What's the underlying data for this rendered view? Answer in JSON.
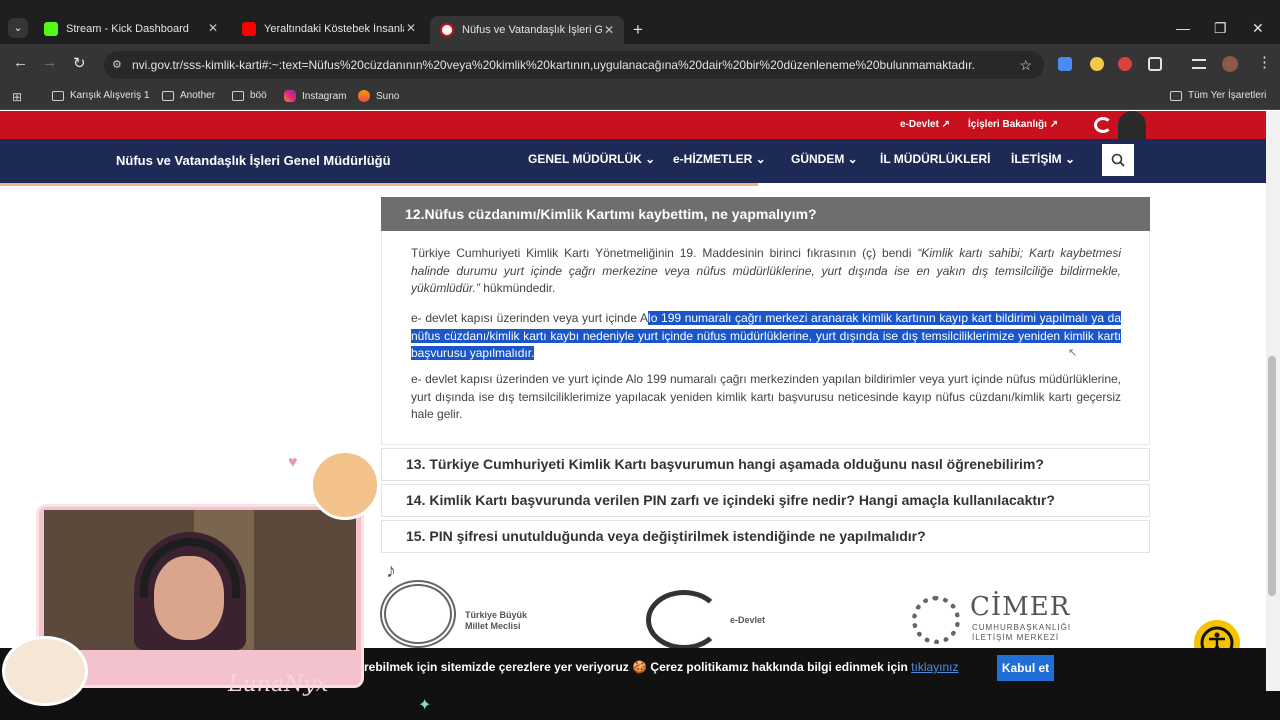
{
  "browser": {
    "tabs": [
      {
        "title": "Stream - Kick Dashboard",
        "favicon_color": "#53fc18"
      },
      {
        "title": "Yeraltındaki Köstebek İnsanlar'a",
        "favicon_color": "#ff0000"
      },
      {
        "title": "Nüfus ve Vatandaşlık İşleri Genel",
        "favicon_color": "#c8101e"
      }
    ],
    "url": "nvi.gov.tr/sss-kimlik-karti#:~:text=Nüfus%20cüzdanının%20veya%20kimlik%20kartının,uygulanacağına%20dair%20bir%20düzenleneme%20bulunmamaktadır.",
    "bookmarks": [
      "Karışık Alışveriş 1",
      "Another",
      "böö",
      "Instagram",
      "Suno"
    ],
    "all_bookmarks": "Tüm Yer İşaretleri"
  },
  "site": {
    "top_links": [
      "e-Devlet",
      "İçişleri Bakanlığı"
    ],
    "title": "Nüfus ve Vatandaşlık İşleri Genel Müdürlüğü",
    "menu": [
      "GENEL MÜDÜRLÜK",
      "e-HİZMETLER",
      "GÜNDEM",
      "İL MÜDÜRLÜKLERİ",
      "İLETİŞİM"
    ]
  },
  "faq": {
    "open_question": "12.Nüfus cüzdanımı/Kimlik Kartımı kaybettim, ne yapmalıyım?",
    "p1_plain": "Türkiye Cumhuriyeti Kimlik Kartı Yönetmeliğinin 19. Maddesinin birinci fıkrasının (ç) bendi ",
    "p1_italic": "“Kimlik kartı sahibi; Kartı kaybetmesi halinde durumu yurt içinde çağrı merkezine veya nüfus müdürlüklerine, yurt dışında ise en yakın dış temsilciliğe bildirmekle, yükümlüdür.”",
    "p1_end": " hükmündedir.",
    "p2_plain": " e- devlet kapısı üzerinden veya yurt içinde A",
    "p2_highlight": "lo 199 numaralı çağrı merkezi aranarak kimlik kartının kayıp kart bildirimi yapılmalı ya da nüfus cüzdanı/kimlik kartı kaybı nedeniyle yurt içinde nüfus müdürlüklerine, yurt dışında ise dış temsilciliklerimize yeniden kimlik kartı başvurusu yapılmalıdır.",
    "p3": "e- devlet kapısı üzerinden ve yurt içinde Alo 199 numaralı çağrı merkezinden yapılan bildirimler veya yurt içinde nüfus müdürlüklerine, yurt dışında ise dış temsilciliklerimize yapılacak yeniden kimlik kartı başvurusu neticesinde kayıp nüfus cüzdanı/kimlik kartı geçersiz hale gelir.",
    "questions": [
      "13. Türkiye Cumhuriyeti Kimlik Kartı başvurumun hangi aşamada olduğunu nasıl öğrenebilirim?",
      "14. Kimlik Kartı başvurunda verilen PIN zarfı ve içindeki şifre nedir? Hangi amaçla kullanılacaktır?",
      "15. PIN şifresi unutulduğunda veya değiştirilmek istendiğinde ne yapılmalıdır?"
    ]
  },
  "logos": {
    "tbmm": [
      "Türkiye Büyük",
      "Millet Meclisi"
    ],
    "edevlet": "e-Devlet",
    "cimer_title": "CİMER",
    "cimer_sub": [
      "CUMHURBAŞKANLIĞI",
      "İLETİŞİM MERKEZİ"
    ]
  },
  "cookie": {
    "text": "rebilmek için sitemizde çerezlere yer veriyoruz 🍪 Çerez politikamız hakkında bilgi edinmek için ",
    "link": "tıklayınız",
    "accept": "Kabul et"
  },
  "overlay": {
    "streamer_name": "LunaNyx"
  }
}
